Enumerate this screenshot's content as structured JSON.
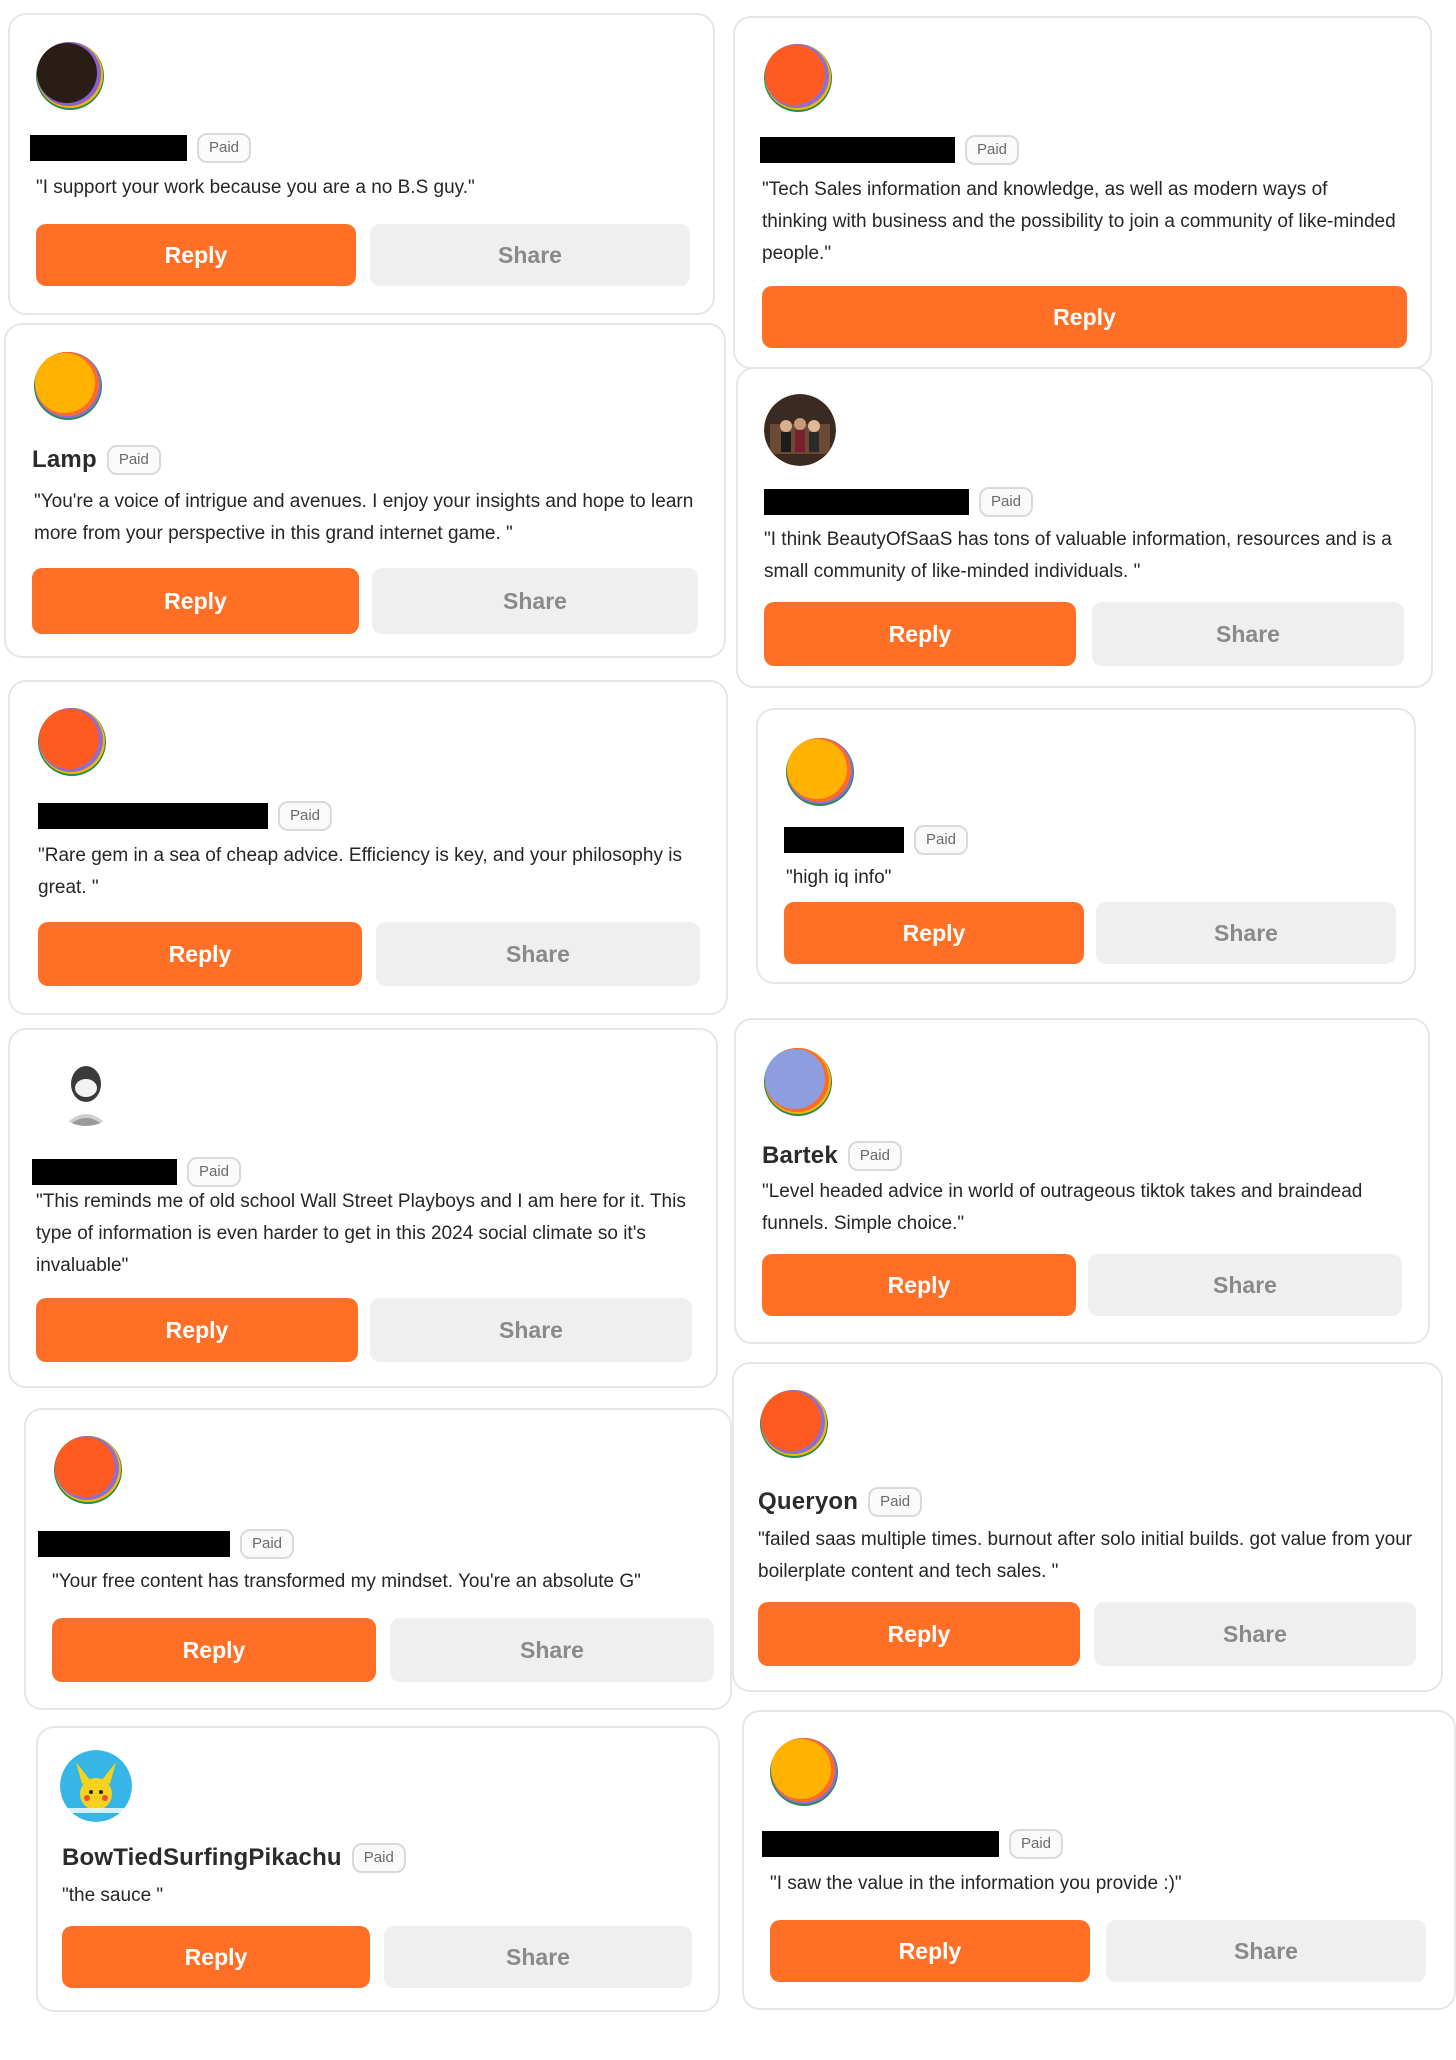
{
  "badge_label": "Paid",
  "reply_label": "Reply",
  "share_label": "Share",
  "colors": {
    "accent": "#ff7026",
    "share_bg": "#efefef",
    "redaction": "#000000"
  },
  "cards": [
    {
      "name": "",
      "name_redacted": true,
      "avatar": "dark-orb-avatar",
      "quote": "\"I support your work because you are a no B.S guy.\"",
      "has_share": true
    },
    {
      "name": "",
      "name_redacted": true,
      "avatar": "orange-orb-avatar",
      "quote": "\"Tech Sales information and knowledge, as well as modern ways of thinking with business and the possibility to join a community of like-minded people.\"",
      "has_share": false
    },
    {
      "name": "Lamp",
      "name_redacted": false,
      "avatar": "yellow-orb-avatar",
      "quote": "\"You're a voice of intrigue and avenues. I enjoy your insights and hope to learn more from your perspective in this grand internet game. \"",
      "has_share": true
    },
    {
      "name": "",
      "name_redacted": true,
      "avatar": "photo-avatar",
      "quote": "\"I think BeautyOfSaaS has tons of valuable information, resources and is a small community of like-minded individuals. \"",
      "has_share": true
    },
    {
      "name": "",
      "name_redacted": true,
      "avatar": "orange-orb-avatar",
      "quote": "\"Rare gem in a sea of cheap advice. Efficiency is key, and your philosophy is great. \"",
      "has_share": true
    },
    {
      "name": "",
      "name_redacted": true,
      "avatar": "yellow-orb-avatar",
      "quote": "\"high iq info\"",
      "has_share": true
    },
    {
      "name": "",
      "name_redacted": true,
      "avatar": "portrait-avatar",
      "quote": "\"This reminds me of old school Wall Street Playboys and I am here for it. This type of information is even harder to get in this 2024 social climate so it's invaluable\"",
      "has_share": true
    },
    {
      "name": "Bartek",
      "name_redacted": false,
      "avatar": "blue-orb-avatar",
      "quote": "\"Level headed advice in world of outrageous tiktok takes and braindead funnels. Simple choice.\"",
      "has_share": true
    },
    {
      "name": "",
      "name_redacted": true,
      "avatar": "orange-orb-avatar",
      "quote": "\"Your free content has transformed my mindset. You're an absolute G\"",
      "has_share": true
    },
    {
      "name": "Queryon",
      "name_redacted": false,
      "avatar": "orange-orb-avatar",
      "quote": "\"failed saas multiple times. burnout after solo initial builds. got value from your boilerplate content and tech sales. \"",
      "has_share": true
    },
    {
      "name": "BowTiedSurfingPikachu",
      "name_redacted": false,
      "avatar": "pikachu-avatar",
      "quote": "\"the sauce \"",
      "has_share": true
    },
    {
      "name": "",
      "name_redacted": true,
      "avatar": "yellow-orb-avatar",
      "quote": "\"I saw the value in the information you provide :)\"",
      "has_share": true
    }
  ]
}
